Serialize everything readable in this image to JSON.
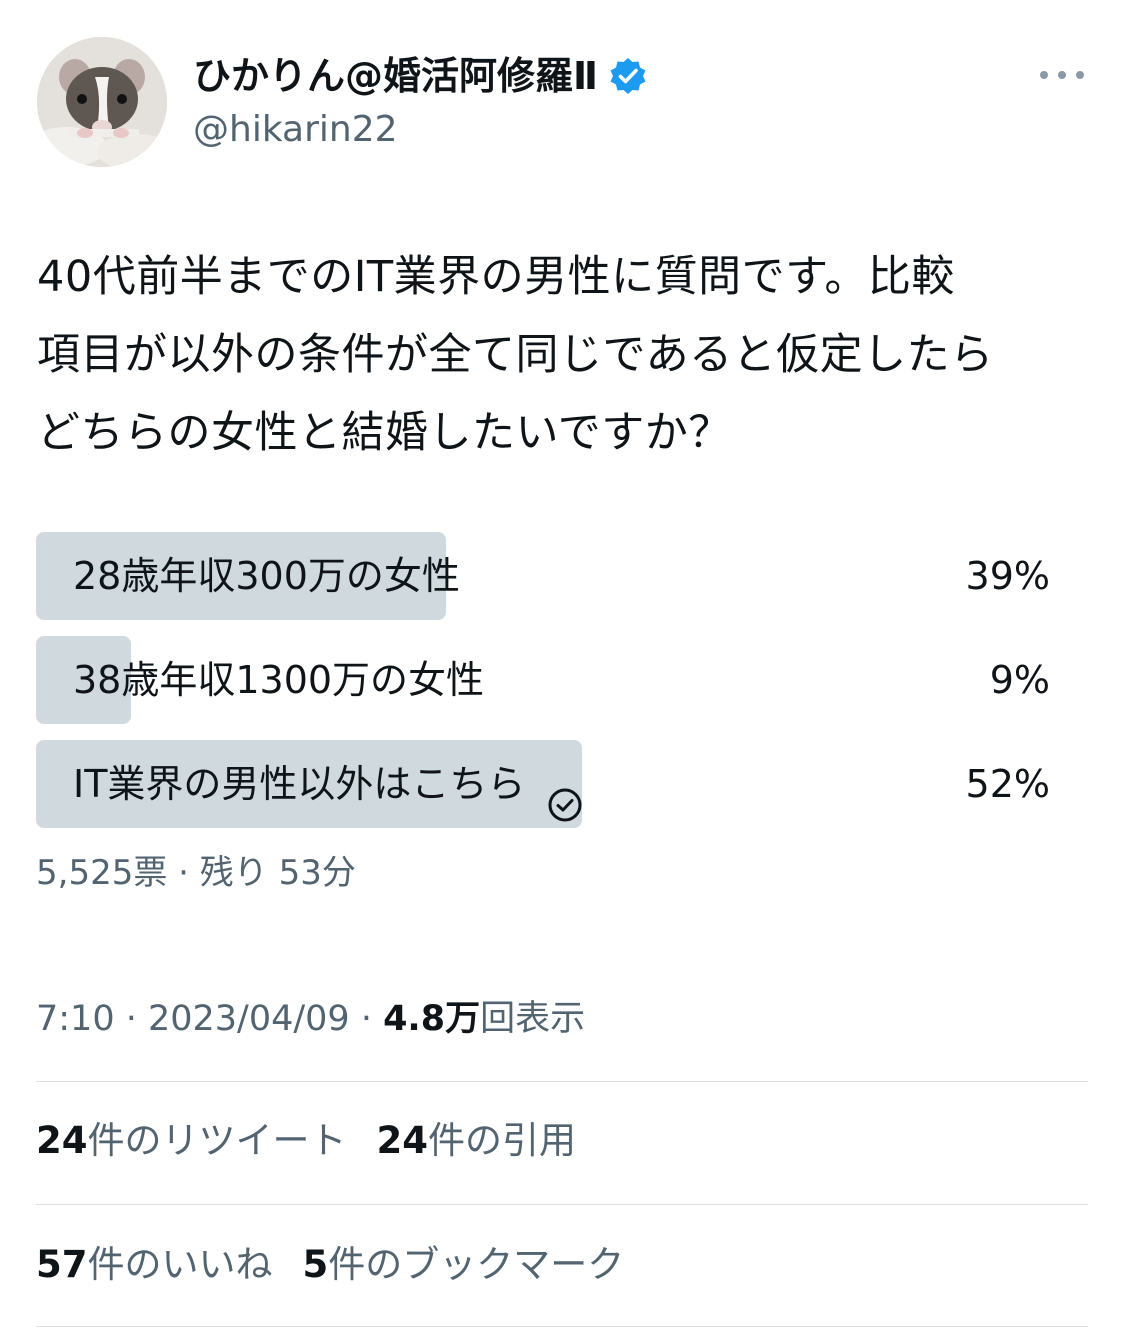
{
  "user": {
    "display_name": "ひかりん@婚活阿修羅Ⅱ",
    "handle": "@hikarin22",
    "verified": true,
    "badge_color": "#1d9bf0"
  },
  "tweet": {
    "lines": [
      "40代前半までのIT業界の男性に質問です。比較",
      "項目が以外の条件が全て同じであると仮定したら",
      "どちらの女性と結婚したいですか？"
    ]
  },
  "poll": {
    "options": [
      {
        "label": "28歳年収300万の女性",
        "percent_text": "39%",
        "percent": 39,
        "selected": false
      },
      {
        "label": "38歳年収1300万の女性",
        "percent_text": "9%",
        "percent": 9,
        "selected": false
      },
      {
        "label": "IT業界の男性以外はこちら",
        "percent_text": "52%",
        "percent": 52,
        "selected": true
      }
    ],
    "summary": "5,525票 · 残り 53分",
    "bar_color": "#cfd9de"
  },
  "meta": {
    "time": "7:10 · 2023/04/09 · ",
    "views_count": "4.8万",
    "views_label": "回表示"
  },
  "stats": {
    "retweets_count": "24",
    "retweets_label": "件のリツイート",
    "quotes_count": "24",
    "quotes_label": "件の引用",
    "likes_count": "57",
    "likes_label": "件のいいね",
    "bookmarks_count": "5",
    "bookmarks_label": "件のブックマーク"
  }
}
